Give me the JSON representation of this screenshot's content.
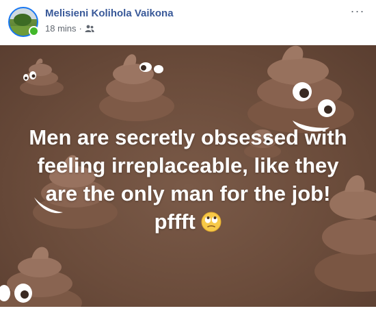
{
  "author": {
    "name": "Melisieni Kolihola Vaikona"
  },
  "meta": {
    "time": "18 mins",
    "separator": "·",
    "audience_icon": "friends-icon"
  },
  "menu": {
    "icon": "more-options-icon",
    "label": "···"
  },
  "post": {
    "lines": [
      "Men are secretly obsessed with",
      "feeling irreplaceable, like they",
      "are the only man for the job!",
      "pffft"
    ],
    "emoji": "face-with-rolling-eyes",
    "background_theme": "poop-emoji",
    "text_color": "#ffffff",
    "background_color": "#6b4c3b"
  },
  "colors": {
    "author": "#385898",
    "meta": "#616770",
    "online": "#42b72a"
  }
}
